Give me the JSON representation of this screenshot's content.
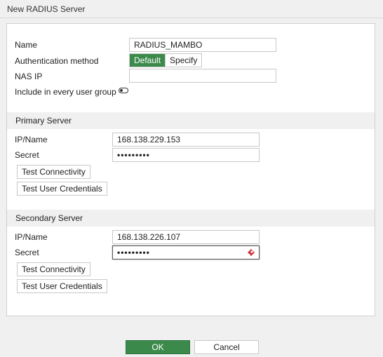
{
  "window": {
    "title": "New RADIUS Server"
  },
  "form": {
    "name_label": "Name",
    "name_value": "RADIUS_MAMBO",
    "auth_label": "Authentication method",
    "auth_options": [
      "Default",
      "Specify"
    ],
    "auth_selected": "Default",
    "nas_ip_label": "NAS IP",
    "nas_ip_value": "",
    "include_group_label": "Include in every user group",
    "include_group_enabled": false
  },
  "primary": {
    "header": "Primary Server",
    "ip_label": "IP/Name",
    "ip_value": "168.138.229.153",
    "secret_label": "Secret",
    "secret_value": "•••••••••",
    "test_connectivity": "Test Connectivity",
    "test_credentials": "Test User Credentials"
  },
  "secondary": {
    "header": "Secondary Server",
    "ip_label": "IP/Name",
    "ip_value": "168.138.226.107",
    "secret_label": "Secret",
    "secret_value": "•••••••••",
    "test_connectivity": "Test Connectivity",
    "test_credentials": "Test User Credentials"
  },
  "footer": {
    "ok": "OK",
    "cancel": "Cancel"
  },
  "colors": {
    "accent": "#3c8a4b",
    "password_icon": "#d0303a"
  },
  "icons": {
    "toggle": "toggle-off-icon",
    "password_manager": "password-key-icon"
  }
}
